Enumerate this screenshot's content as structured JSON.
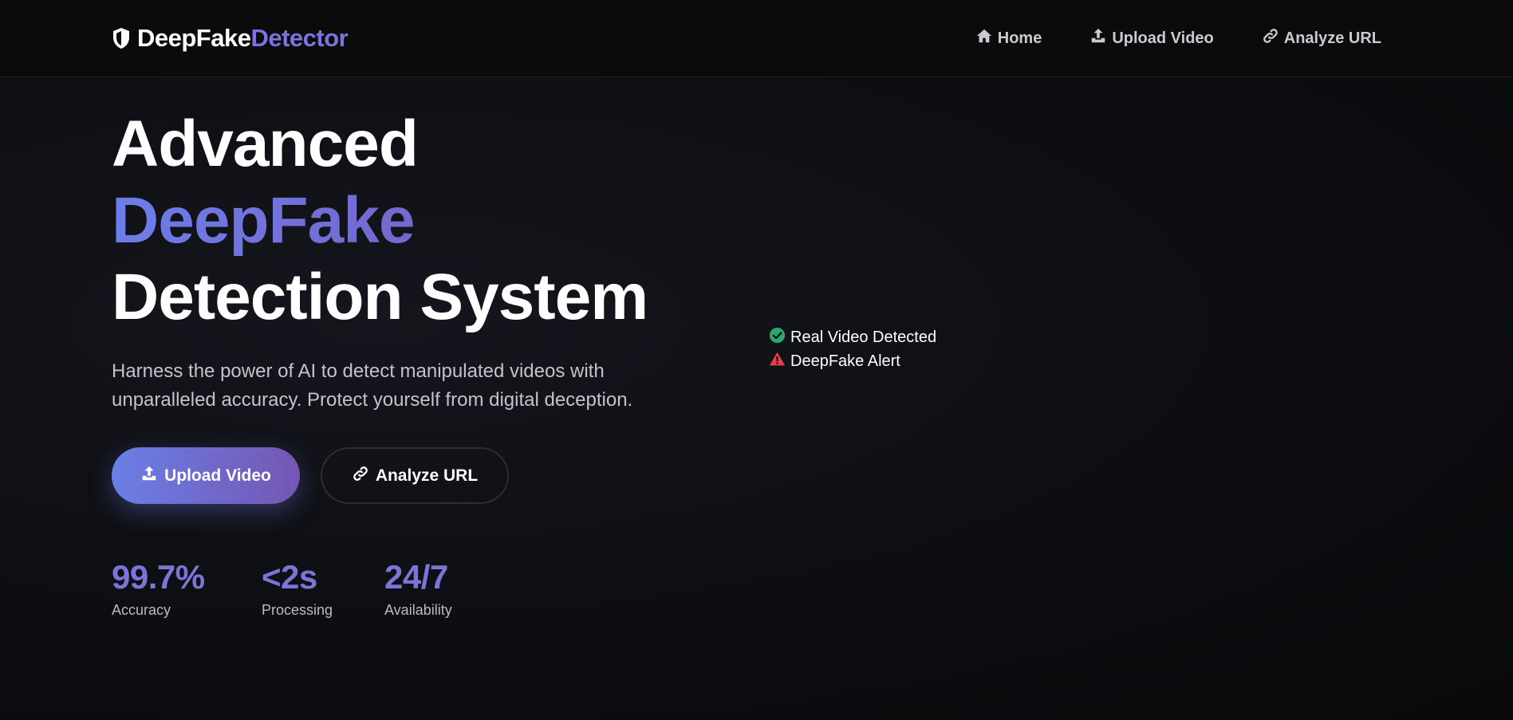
{
  "brand": {
    "name_part1": "DeepFake",
    "name_part2": "Detector",
    "icon": "shield-icon"
  },
  "nav": {
    "items": [
      {
        "label": "Home",
        "icon": "home-icon"
      },
      {
        "label": "Upload Video",
        "icon": "upload-icon"
      },
      {
        "label": "Analyze URL",
        "icon": "link-icon"
      }
    ]
  },
  "hero": {
    "title_line1": "Advanced",
    "title_line2": "DeepFake",
    "title_line3": "Detection System",
    "subtitle_line1": "Harness the power of AI to detect manipulated videos with",
    "subtitle_line2": "unparalleled accuracy. Protect yourself from digital deception.",
    "primary_button": "Upload Video",
    "secondary_button": "Analyze URL"
  },
  "stats": [
    {
      "value": "99.7%",
      "label": "Accuracy"
    },
    {
      "value": "<2s",
      "label": "Processing"
    },
    {
      "value": "24/7",
      "label": "Availability"
    }
  ],
  "status": {
    "real": {
      "label": "Real Video Detected",
      "icon": "check-circle-icon"
    },
    "fake": {
      "label": "DeepFake Alert",
      "icon": "warning-triangle-icon"
    }
  },
  "colors": {
    "accent": "#7a76d8",
    "gradient_start": "#6a7fe6",
    "gradient_end": "#7656b3",
    "success": "#27a96b",
    "danger": "#e5414b",
    "background": "#0b0b0d"
  }
}
